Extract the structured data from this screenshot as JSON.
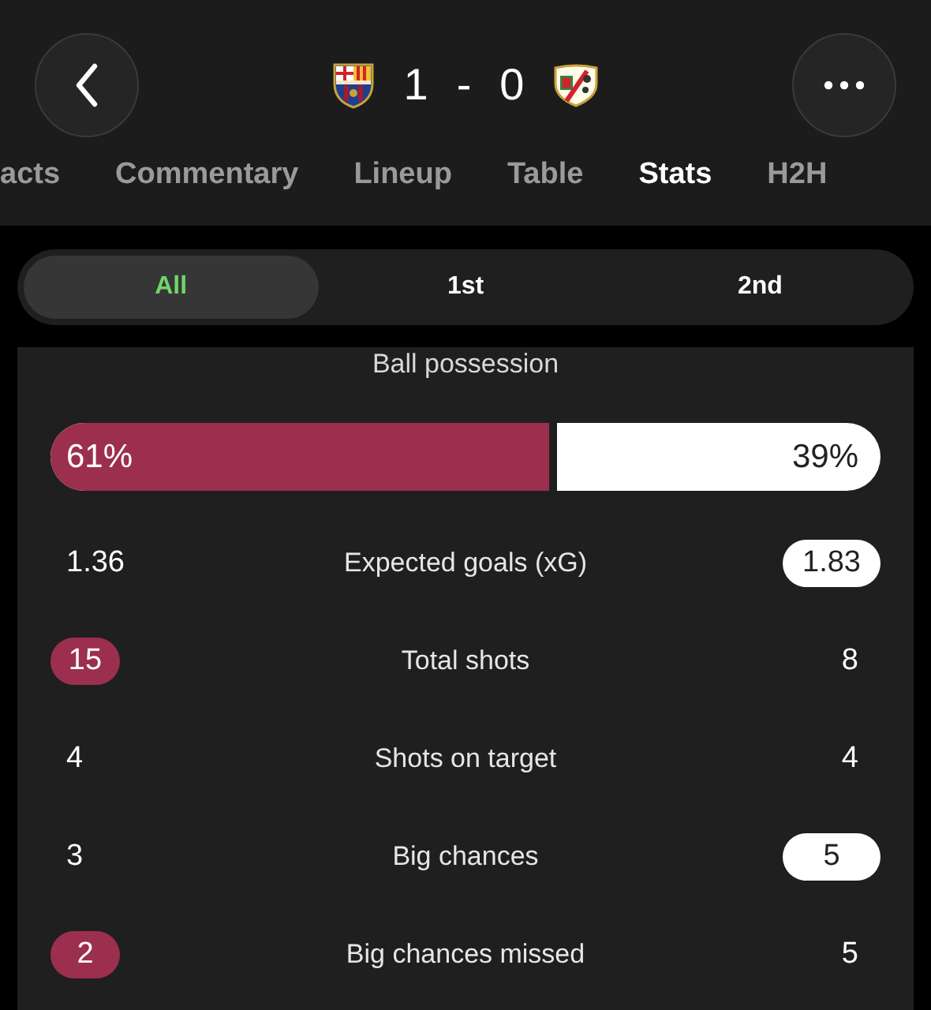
{
  "header": {
    "home_score": "1",
    "separator": "-",
    "away_score": "0"
  },
  "tabs": [
    {
      "label": "acts",
      "selected": false
    },
    {
      "label": "Commentary",
      "selected": false
    },
    {
      "label": "Lineup",
      "selected": false
    },
    {
      "label": "Table",
      "selected": false
    },
    {
      "label": "Stats",
      "selected": true
    },
    {
      "label": "H2H",
      "selected": false
    }
  ],
  "periods": [
    {
      "label": "All",
      "selected": true
    },
    {
      "label": "1st",
      "selected": false
    },
    {
      "label": "2nd",
      "selected": false
    }
  ],
  "possession": {
    "title": "Ball possession",
    "home": "61%",
    "away": "39%",
    "level": 0.61
  },
  "stats": [
    {
      "home": "1.36",
      "name": "Expected goals (xG)",
      "away": "1.83",
      "home_highlighted": false,
      "away_highlighted": true
    },
    {
      "home": "15",
      "name": "Total shots",
      "away": "8",
      "home_highlighted": true,
      "away_highlighted": false
    },
    {
      "home": "4",
      "name": "Shots on target",
      "away": "4",
      "home_highlighted": false,
      "away_highlighted": false
    },
    {
      "home": "3",
      "name": "Big chances",
      "away": "5",
      "home_highlighted": false,
      "away_highlighted": true
    },
    {
      "home": "2",
      "name": "Big chances missed",
      "away": "5",
      "home_highlighted": true,
      "away_highlighted": false
    }
  ]
}
